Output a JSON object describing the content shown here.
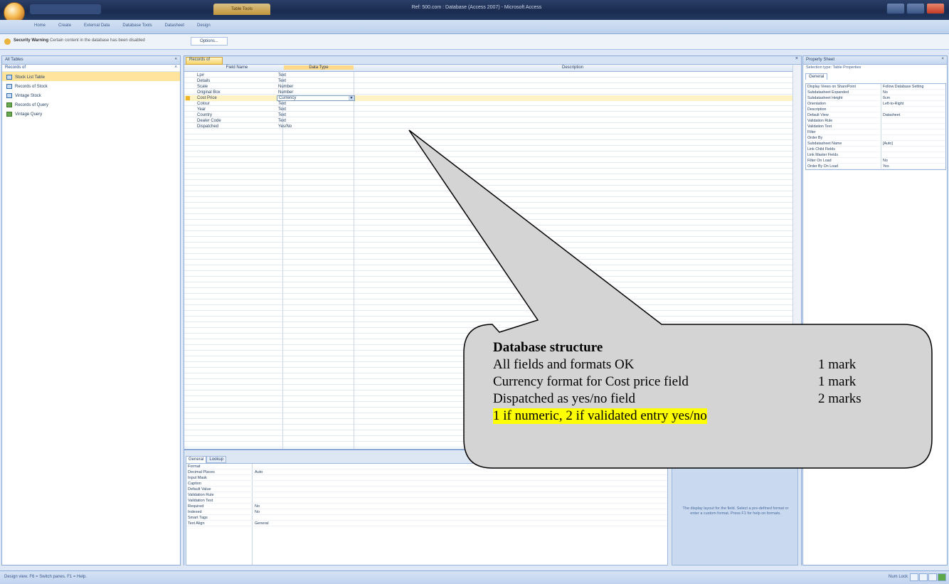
{
  "window": {
    "title": "Ref: 500.com : Database (Access 2007) - Microsoft Access",
    "context_tab": "Table Tools"
  },
  "ribbon": {
    "tabs": [
      "Home",
      "Create",
      "External Data",
      "Database Tools",
      "Datasheet",
      "Design"
    ]
  },
  "security": {
    "label": "Security Warning",
    "message": "Certain content in the database has been disabled",
    "options_button": "Options..."
  },
  "nav": {
    "header": "All Tables",
    "group": "Records of",
    "items": [
      {
        "label": "Stock List Table",
        "selected": true,
        "kind": "table"
      },
      {
        "label": "Records of Stock",
        "selected": false,
        "kind": "table"
      },
      {
        "label": "Vintage Stock",
        "selected": false,
        "kind": "table"
      },
      {
        "label": "Records of Query",
        "selected": false,
        "kind": "query"
      },
      {
        "label": "Vintage Query",
        "selected": false,
        "kind": "query"
      }
    ]
  },
  "design": {
    "tab_label": "Records of",
    "headers": {
      "field": "Field Name",
      "type": "Data Type",
      "desc": "Description"
    },
    "fields": [
      {
        "name": "Lp#",
        "type": "Text"
      },
      {
        "name": "Details",
        "type": "Text"
      },
      {
        "name": "Scale",
        "type": "Number"
      },
      {
        "name": "Original Box",
        "type": "Number"
      },
      {
        "name": "Cost Price",
        "type": "Currency",
        "selected": true
      },
      {
        "name": "Colour",
        "type": "Text"
      },
      {
        "name": "Year",
        "type": "Text"
      },
      {
        "name": "Country",
        "type": "Text"
      },
      {
        "name": "Dealer Code",
        "type": "Text"
      },
      {
        "name": "Dispatched",
        "type": "Yes/No"
      }
    ]
  },
  "field_props": {
    "tabs": {
      "general": "General",
      "lookup": "Lookup"
    },
    "rows": [
      {
        "name": "Format",
        "value": ""
      },
      {
        "name": "Decimal Places",
        "value": "Auto"
      },
      {
        "name": "Input Mask",
        "value": ""
      },
      {
        "name": "Caption",
        "value": ""
      },
      {
        "name": "Default Value",
        "value": ""
      },
      {
        "name": "Validation Rule",
        "value": ""
      },
      {
        "name": "Validation Text",
        "value": ""
      },
      {
        "name": "Required",
        "value": "No"
      },
      {
        "name": "Indexed",
        "value": "No"
      },
      {
        "name": "Smart Tags",
        "value": ""
      },
      {
        "name": "Text Align",
        "value": "General"
      }
    ],
    "hint": "The display layout for the field. Select a pre-defined format or enter a custom format. Press F1 for help on formats."
  },
  "property_sheet": {
    "title": "Property Sheet",
    "selection": "Selection type: Table Properties",
    "tab": "General",
    "rows": [
      {
        "name": "Display Views on SharePoint",
        "value": "Follow Database Setting"
      },
      {
        "name": "Subdatasheet Expanded",
        "value": "No"
      },
      {
        "name": "Subdatasheet Height",
        "value": "0cm"
      },
      {
        "name": "Orientation",
        "value": "Left-to-Right"
      },
      {
        "name": "Description",
        "value": ""
      },
      {
        "name": "Default View",
        "value": "Datasheet"
      },
      {
        "name": "Validation Rule",
        "value": ""
      },
      {
        "name": "Validation Text",
        "value": ""
      },
      {
        "name": "Filter",
        "value": ""
      },
      {
        "name": "Order By",
        "value": ""
      },
      {
        "name": "Subdatasheet Name",
        "value": "[Auto]"
      },
      {
        "name": "Link Child Fields",
        "value": ""
      },
      {
        "name": "Link Master Fields",
        "value": ""
      },
      {
        "name": "Filter On Load",
        "value": "No"
      },
      {
        "name": "Order By On Load",
        "value": "Yes"
      }
    ]
  },
  "status": {
    "left": "Design view.  F6 = Switch panes.  F1 = Help.",
    "right": "Num Lock"
  },
  "callout": {
    "title": "Database structure",
    "lines": [
      {
        "text": "All fields and formats OK",
        "marks": "1 mark"
      },
      {
        "text": "Currency format for Cost price field",
        "marks": "1 mark"
      },
      {
        "text": "Dispatched as yes/no field",
        "marks": "2 marks"
      }
    ],
    "note": "1 if numeric, 2 if validated entry yes/no"
  }
}
